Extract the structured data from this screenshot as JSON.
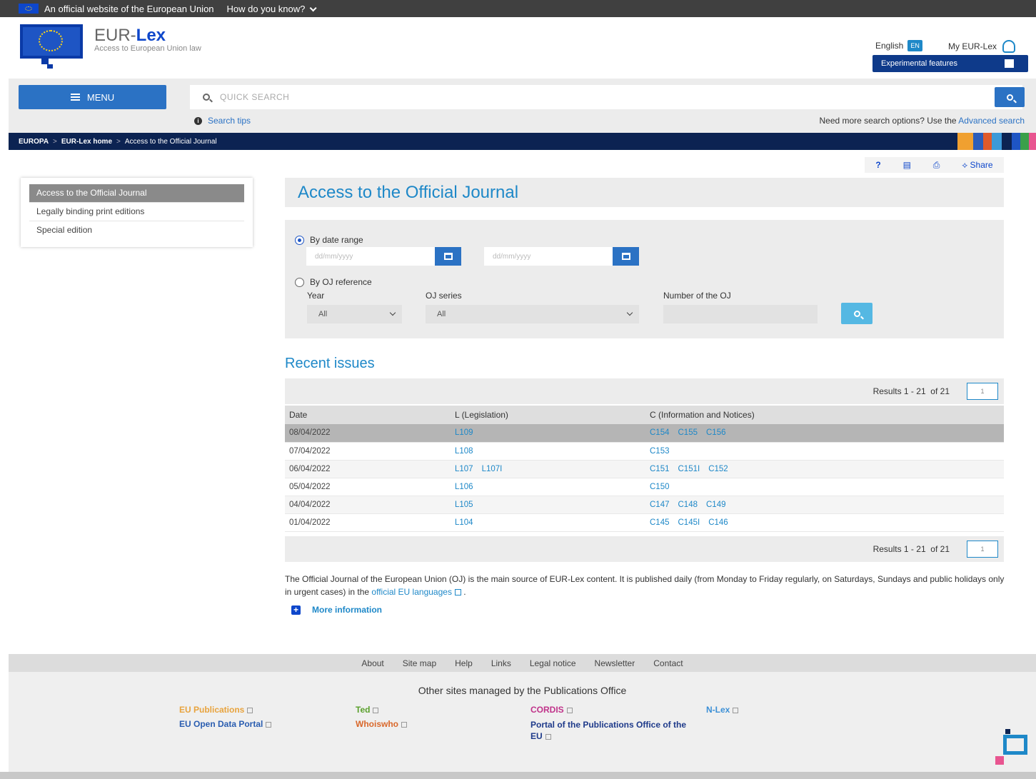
{
  "eu_bar": {
    "official_text": "An official website of the European Union",
    "how_text": "How do you know?"
  },
  "header": {
    "brand_prefix": "EUR-",
    "brand_suffix": "Lex",
    "brand_sub": "Access to European Union law",
    "language": "English",
    "language_code": "EN",
    "my_eurlex": "My EUR-Lex",
    "experimental": "Experimental features"
  },
  "search": {
    "menu_label": "MENU",
    "placeholder": "QUICK SEARCH",
    "tips": "Search tips",
    "advanced_prefix": "Need more search options? Use the",
    "advanced_link": "Advanced search"
  },
  "breadcrumb": [
    "EUROPA",
    "EUR-Lex home",
    "Access to the Official Journal"
  ],
  "tools": {
    "help": "?",
    "share": "Share"
  },
  "sidebar": {
    "items": [
      {
        "label": "Access to the Official Journal"
      },
      {
        "label": "Legally binding print editions"
      },
      {
        "label": "Special edition"
      }
    ]
  },
  "main": {
    "title": "Access to the Official Journal",
    "by_date_range": "By date range",
    "date_placeholder": "dd/mm/yyyy",
    "by_oj_reference": "By OJ reference",
    "year_label": "Year",
    "year_value": "All",
    "series_label": "OJ series",
    "series_value": "All",
    "number_label": "Number of the OJ",
    "recent_title": "Recent issues",
    "results_prefix": "Results 1 -",
    "results_count": "21",
    "results_of": "of 21",
    "page": "1"
  },
  "table": {
    "headers": [
      "Date",
      "L (Legislation)",
      "C (Information and Notices)"
    ],
    "rows": [
      {
        "date": "08/04/2022",
        "l": [
          "L109"
        ],
        "c": [
          "C154",
          "C155",
          "C156"
        ]
      },
      {
        "date": "07/04/2022",
        "l": [
          "L108"
        ],
        "c": [
          "C153"
        ]
      },
      {
        "date": "06/04/2022",
        "l": [
          "L107",
          "L107I"
        ],
        "c": [
          "C151",
          "C151I",
          "C152"
        ]
      },
      {
        "date": "05/04/2022",
        "l": [
          "L106"
        ],
        "c": [
          "C150"
        ]
      },
      {
        "date": "04/04/2022",
        "l": [
          "L105"
        ],
        "c": [
          "C147",
          "C148",
          "C149"
        ]
      },
      {
        "date": "01/04/2022",
        "l": [
          "L104"
        ],
        "c": [
          "C145",
          "C145I",
          "C146"
        ]
      }
    ]
  },
  "description": {
    "text": "The Official Journal of the European Union (OJ) is the main source of EUR-Lex content. It is published daily (from Monday to Friday regularly, on Saturdays, Sundays and public holidays only in urgent cases) in the",
    "link": "official EU languages",
    "more": "More information"
  },
  "footer": {
    "links": [
      "About",
      "Site map",
      "Help",
      "Links",
      "Legal notice",
      "Newsletter",
      "Contact"
    ],
    "other_title": "Other sites managed by the Publications Office",
    "sites": [
      {
        "label": "EU Publications",
        "color": "#e8a33d"
      },
      {
        "label": "Ted",
        "color": "#5aa02c"
      },
      {
        "label": "CORDIS",
        "color": "#c0338a"
      },
      {
        "label": "N-Lex",
        "color": "#3b8fd6"
      },
      {
        "label": "EU Open Data Portal",
        "color": "#2a5db0"
      },
      {
        "label": "Whoiswho",
        "color": "#d9672a"
      },
      {
        "label": "Portal of the Publications Office of the EU",
        "color": "#1e3a8a"
      }
    ]
  },
  "colors": {
    "accent": "#1e88c8",
    "primary_button": "#2b72c4",
    "breadcrumb_bg": "#0c2352"
  }
}
